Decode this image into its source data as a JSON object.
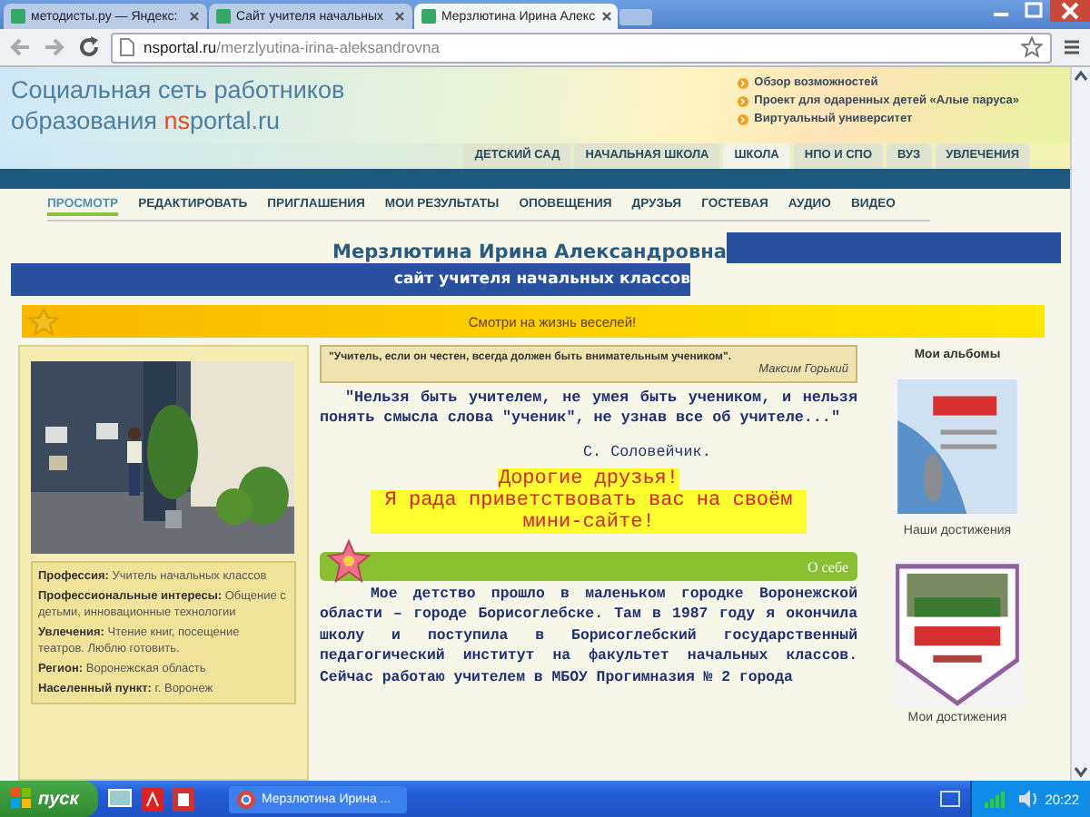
{
  "browser": {
    "tabs": [
      {
        "title": "методисты.ру — Яндекс:",
        "selected": false
      },
      {
        "title": "Сайт учителя начальных",
        "selected": false
      },
      {
        "title": "Мерзлютина Ирина Алекс",
        "selected": true
      }
    ],
    "url_host": "nsportal.ru",
    "url_path": "/merzlyutina-irina-aleksandrovna"
  },
  "header": {
    "logo_line1": "Социальная сеть работников",
    "logo_line2": "образования",
    "logo_ns": "ns",
    "logo_rest": "portal.ru",
    "links": [
      "Обзор возможностей",
      "Проект для одаренных детей «Алые паруса»",
      "Виртуальный университет"
    ]
  },
  "sections": [
    {
      "label": "ДЕТСКИЙ САД",
      "selected": false
    },
    {
      "label": "НАЧАЛЬНАЯ ШКОЛА",
      "selected": false
    },
    {
      "label": "ШКОЛА",
      "selected": true
    },
    {
      "label": "НПО И СПО",
      "selected": false
    },
    {
      "label": "ВУЗ",
      "selected": false
    },
    {
      "label": "УВЛЕЧЕНИЯ",
      "selected": false
    }
  ],
  "nav": [
    {
      "label": "ПРОСМОТР",
      "selected": true
    },
    {
      "label": "РЕДАКТИРОВАТЬ",
      "selected": false
    },
    {
      "label": "ПРИГЛАШЕНИЯ",
      "selected": false
    },
    {
      "label": "МОИ РЕЗУЛЬТАТЫ",
      "selected": false
    },
    {
      "label": "ОПОВЕЩЕНИЯ",
      "selected": false
    },
    {
      "label": "ДРУЗЬЯ",
      "selected": false
    },
    {
      "label": "ГОСТЕВАЯ",
      "selected": false
    },
    {
      "label": "АУДИО",
      "selected": false
    },
    {
      "label": "ВИДЕО",
      "selected": false
    }
  ],
  "profile": {
    "name": "Мерзлютина Ирина Александровна",
    "subtitle": "сайт учителя начальных классов",
    "banner": "Смотри на жизнь веселей!"
  },
  "sidebar": {
    "facts": [
      {
        "label": "Профессия:",
        "value": "Учитель начальных классов"
      },
      {
        "label": "Профессиональные интересы:",
        "value": "Общение с детьми, инновационные технологии"
      },
      {
        "label": "Увлечения:",
        "value": "Чтение книг, посещение театров. Люблю готовить."
      },
      {
        "label": "Регион:",
        "value": "Воронежская область"
      },
      {
        "label": "Населенный пункт:",
        "value": "г. Воронеж"
      }
    ]
  },
  "main": {
    "quote": "\"Учитель, если он честен, всегда должен быть внимательным учеником\".",
    "quote_author": "Максим Горький",
    "epigraph": "\"Нельзя быть учителем, не умея быть учеником, и нельзя понять смысла слова \"ученик\", не узнав все об учителе...\"",
    "epigraph_author": "С. Соловейчик.",
    "greeting": [
      "Дорогие друзья!",
      "Я рада приветствовать вас на своём мини-сайте!"
    ],
    "section_title": "О себе",
    "about": "Мое детство прошло в маленьком городке Воронежской области – городе Борисоглебске. Там в 1987 году я окончила школу и поступила в Борисоглебский государственный педагогический институт на факультет начальных классов. Сейчас работаю учителем в МБОУ Прогимназия № 2 города"
  },
  "albums": {
    "title": "Мои альбомы",
    "items": [
      {
        "caption": "Наши достижения"
      },
      {
        "caption": "Мои достижения"
      }
    ]
  },
  "taskbar": {
    "start": "пуск",
    "task": "Мерзлютина Ирина ...",
    "clock": "20:22"
  }
}
